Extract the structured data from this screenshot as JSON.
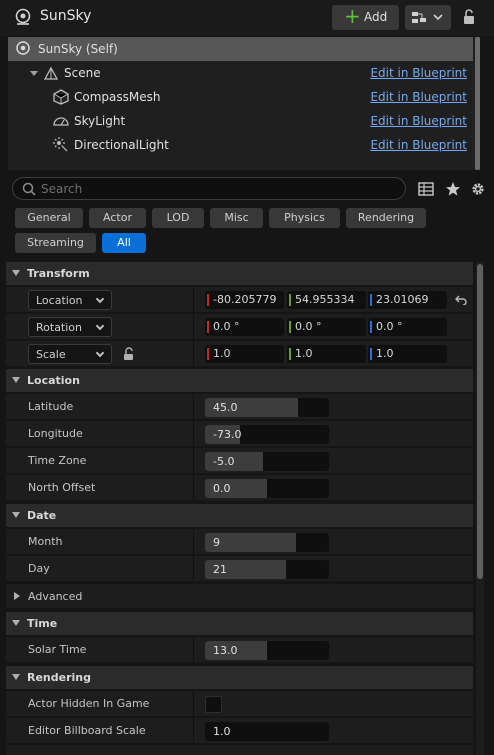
{
  "header": {
    "title": "SunSky",
    "add_label": "Add"
  },
  "tree": {
    "items": [
      {
        "label": "SunSky (Self)",
        "link": ""
      },
      {
        "label": "Scene",
        "link": "Edit in Blueprint"
      },
      {
        "label": "CompassMesh",
        "link": "Edit in Blueprint"
      },
      {
        "label": "SkyLight",
        "link": "Edit in Blueprint"
      },
      {
        "label": "DirectionalLight",
        "link": "Edit in Blueprint"
      }
    ]
  },
  "search": {
    "placeholder": "Search"
  },
  "filters": {
    "tabs": [
      "General",
      "Actor",
      "LOD",
      "Misc",
      "Physics",
      "Rendering",
      "Streaming",
      "All"
    ],
    "active": "All"
  },
  "transform": {
    "title": "Transform",
    "location": {
      "label": "Location",
      "x": "-80.205779",
      "y": "54.955334",
      "z": "23.01069"
    },
    "rotation": {
      "label": "Rotation",
      "x": "0.0 °",
      "y": "0.0 °",
      "z": "0.0 °"
    },
    "scale": {
      "label": "Scale",
      "x": "1.0",
      "y": "1.0",
      "z": "1.0"
    }
  },
  "location_section": {
    "title": "Location",
    "latitude": {
      "label": "Latitude",
      "value": "45.0",
      "fill": 0.75
    },
    "longitude": {
      "label": "Longitude",
      "value": "-73.0",
      "fill": 0.28
    },
    "timezone": {
      "label": "Time Zone",
      "value": "-5.0",
      "fill": 0.47
    },
    "north_offset": {
      "label": "North Offset",
      "value": "0.0",
      "fill": 0.5
    }
  },
  "date_section": {
    "title": "Date",
    "month": {
      "label": "Month",
      "value": "9",
      "fill": 0.73
    },
    "day": {
      "label": "Day",
      "value": "21",
      "fill": 0.65
    },
    "advanced": "Advanced"
  },
  "time_section": {
    "title": "Time",
    "solar_time": {
      "label": "Solar Time",
      "value": "13.0",
      "fill": 0.5
    }
  },
  "rendering_section": {
    "title": "Rendering",
    "hidden": {
      "label": "Actor Hidden In Game",
      "checked": false
    },
    "billboard": {
      "label": "Editor Billboard Scale",
      "value": "1.0"
    }
  },
  "colors": {
    "x_axis": "#c2291e",
    "y_axis": "#6a9e2a",
    "z_axis": "#2d6fd6",
    "accent": "#0a6fd6",
    "link": "#75a8ee"
  }
}
